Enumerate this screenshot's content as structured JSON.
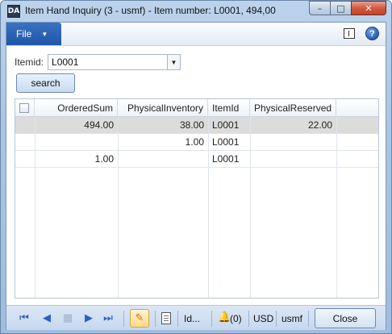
{
  "window": {
    "title": "Item Hand Inquiry (3 - usmf) - Item number: L0001, 494,00",
    "icon_text": "DA",
    "controls": {
      "minimize": "–",
      "maximize": "□",
      "close": "✕"
    }
  },
  "menubar": {
    "file_label": "File",
    "file_caret": "▼",
    "help_label": "?"
  },
  "filter": {
    "itemid_label": "Itemid:",
    "itemid_value": "L0001",
    "dropdown_arrow": "▼"
  },
  "search_label": "search",
  "grid": {
    "columns": [
      "OrderedSum",
      "PhysicalInventory",
      "ItemId",
      "PhysicalReserved"
    ],
    "rows": [
      {
        "OrderedSum": "494.00",
        "PhysicalInventory": "38.00",
        "ItemId": "L0001",
        "PhysicalReserved": "22.00"
      },
      {
        "OrderedSum": "",
        "PhysicalInventory": "1.00",
        "ItemId": "L0001",
        "PhysicalReserved": ""
      },
      {
        "OrderedSum": "1.00",
        "PhysicalInventory": "",
        "ItemId": "L0001",
        "PhysicalReserved": ""
      }
    ]
  },
  "statusbar": {
    "nav_first": "⏮",
    "nav_prev": "◀",
    "nav_grid": "▦",
    "nav_next": "▶",
    "nav_last": "⏭",
    "edit_icon": "✎",
    "id_label": "Id...",
    "notifications": "(0)",
    "currency": "USD",
    "company": "usmf",
    "close_label": "Close"
  },
  "icons": [
    "app-icon",
    "minimize-icon",
    "maximize-icon",
    "close-icon",
    "panel-icon",
    "help-icon",
    "dropdown-arrow-icon",
    "checkbox-icon",
    "first-record-icon",
    "previous-record-icon",
    "grid-view-icon",
    "next-record-icon",
    "last-record-icon",
    "edit-pencil-icon",
    "document-icon",
    "bell-icon"
  ],
  "colors": {
    "file_button": "#1f55a8",
    "selected_row": "#dcdcdc",
    "nav_arrows": "#2b62c0",
    "edit_highlight": "#ffd98a"
  }
}
